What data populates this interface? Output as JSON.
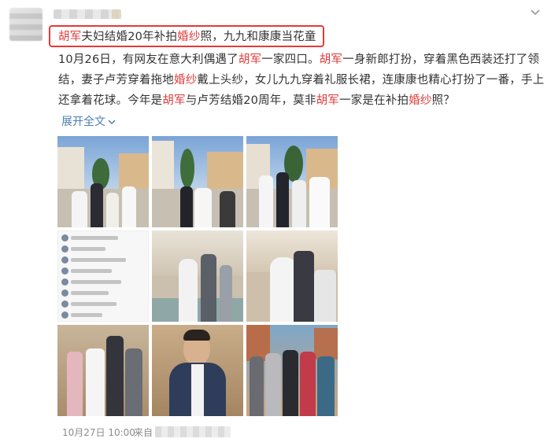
{
  "post": {
    "title_parts": [
      "胡军",
      "夫妇结婚20年补拍",
      "婚纱",
      "照，九九和康康当花童"
    ],
    "body_lines": [
      [
        "10月26日，有网友在意大利偶遇了",
        "胡军",
        "一家四口。",
        "胡军",
        "一身新郎打扮，穿着黑色西装还打了领"
      ],
      [
        "结，妻子卢芳穿着拖地",
        "婚纱",
        "戴上头纱，女儿九九穿着礼服长裙，连康康也精心打扮了一番，手上"
      ],
      [
        "还拿着花球。今年是",
        "胡军",
        "与卢芳结婚20周年，莫非",
        "胡军",
        "一家是在补拍",
        "婚纱",
        "照？"
      ]
    ],
    "expand_label": "展开全文",
    "timestamp": "10月27日 10:00",
    "source_prefix": "来自"
  },
  "icons": {
    "expand_chevron": "chevron-down-icon",
    "more_menu": "chevron-down-icon"
  },
  "colors": {
    "highlight_text": "#e03c3c",
    "highlight_box": "#e53935",
    "link": "#4a7fb5",
    "meta": "#8b8b8b"
  },
  "photos": [
    {
      "name": "photo-wedding-steps-1"
    },
    {
      "name": "photo-wedding-steps-2"
    },
    {
      "name": "photo-wedding-steps-3"
    },
    {
      "name": "photo-comment-screenshot"
    },
    {
      "name": "photo-fountain-couple"
    },
    {
      "name": "photo-fountain-kiss"
    },
    {
      "name": "photo-ruins-family"
    },
    {
      "name": "photo-man-closeup"
    },
    {
      "name": "photo-group-sunset"
    }
  ]
}
